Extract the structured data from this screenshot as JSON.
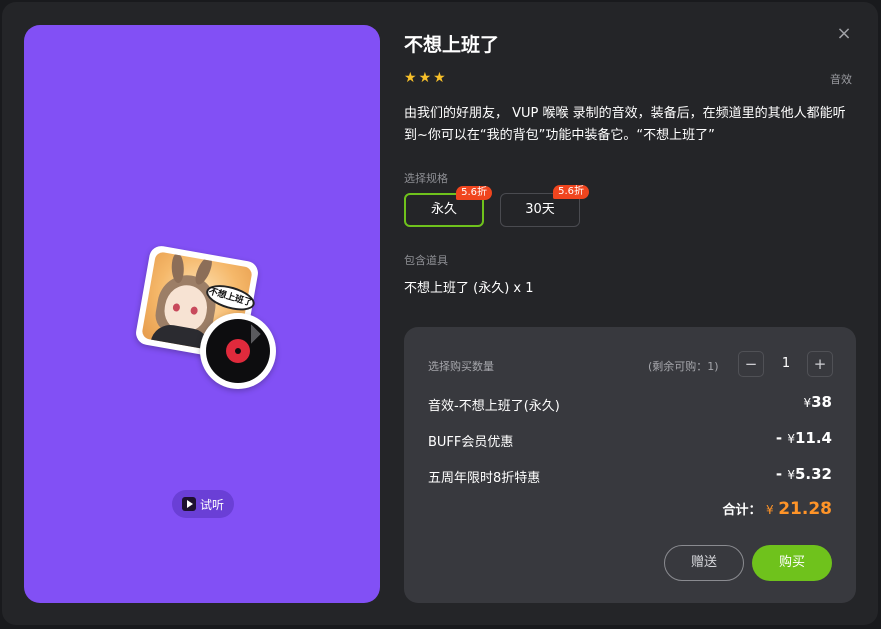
{
  "item": {
    "title": "不想上班了",
    "category": "音效",
    "rating_stars": 3,
    "description": "由我们的好朋友， VUP 喉喉 录制的音效，装备后，在频道里的其他人都能听到~你可以在“我的背包”功能中装备它。“不想上班了”",
    "cover_bubble_text": "不想上班了",
    "listen_label": "试听"
  },
  "close_icon": "×",
  "star_icon": "★",
  "spec": {
    "label": "选择规格",
    "options": [
      {
        "label": "永久",
        "badge": "5.6折",
        "selected": true
      },
      {
        "label": "30天",
        "badge": "5.6折",
        "selected": false
      }
    ]
  },
  "includes": {
    "label": "包含道具",
    "item": "不想上班了 (永久) x 1"
  },
  "purchase": {
    "qty_label": "选择购买数量",
    "remaining": "(剩余可购：1)",
    "minus": "−",
    "plus": "+",
    "quantity": "1",
    "lines": [
      {
        "name": "音效-不想上班了(永久)",
        "sign": "¥",
        "prefix": "",
        "amount": "38"
      },
      {
        "name": "BUFF会员优惠",
        "sign": "¥",
        "prefix": "- ",
        "amount": "11.4"
      },
      {
        "name": "五周年限时8折特惠",
        "sign": "¥",
        "prefix": "- ",
        "amount": "5.32"
      }
    ],
    "total_label": "合计：",
    "total_sign": "¥",
    "total_amount": "21.28",
    "gift_label": "赠送",
    "buy_label": "购买"
  },
  "colors": {
    "accent_green": "#6fc21c",
    "discount_red": "#f0451e",
    "total_orange": "#ff9428",
    "cover_purple": "#8250f5"
  }
}
